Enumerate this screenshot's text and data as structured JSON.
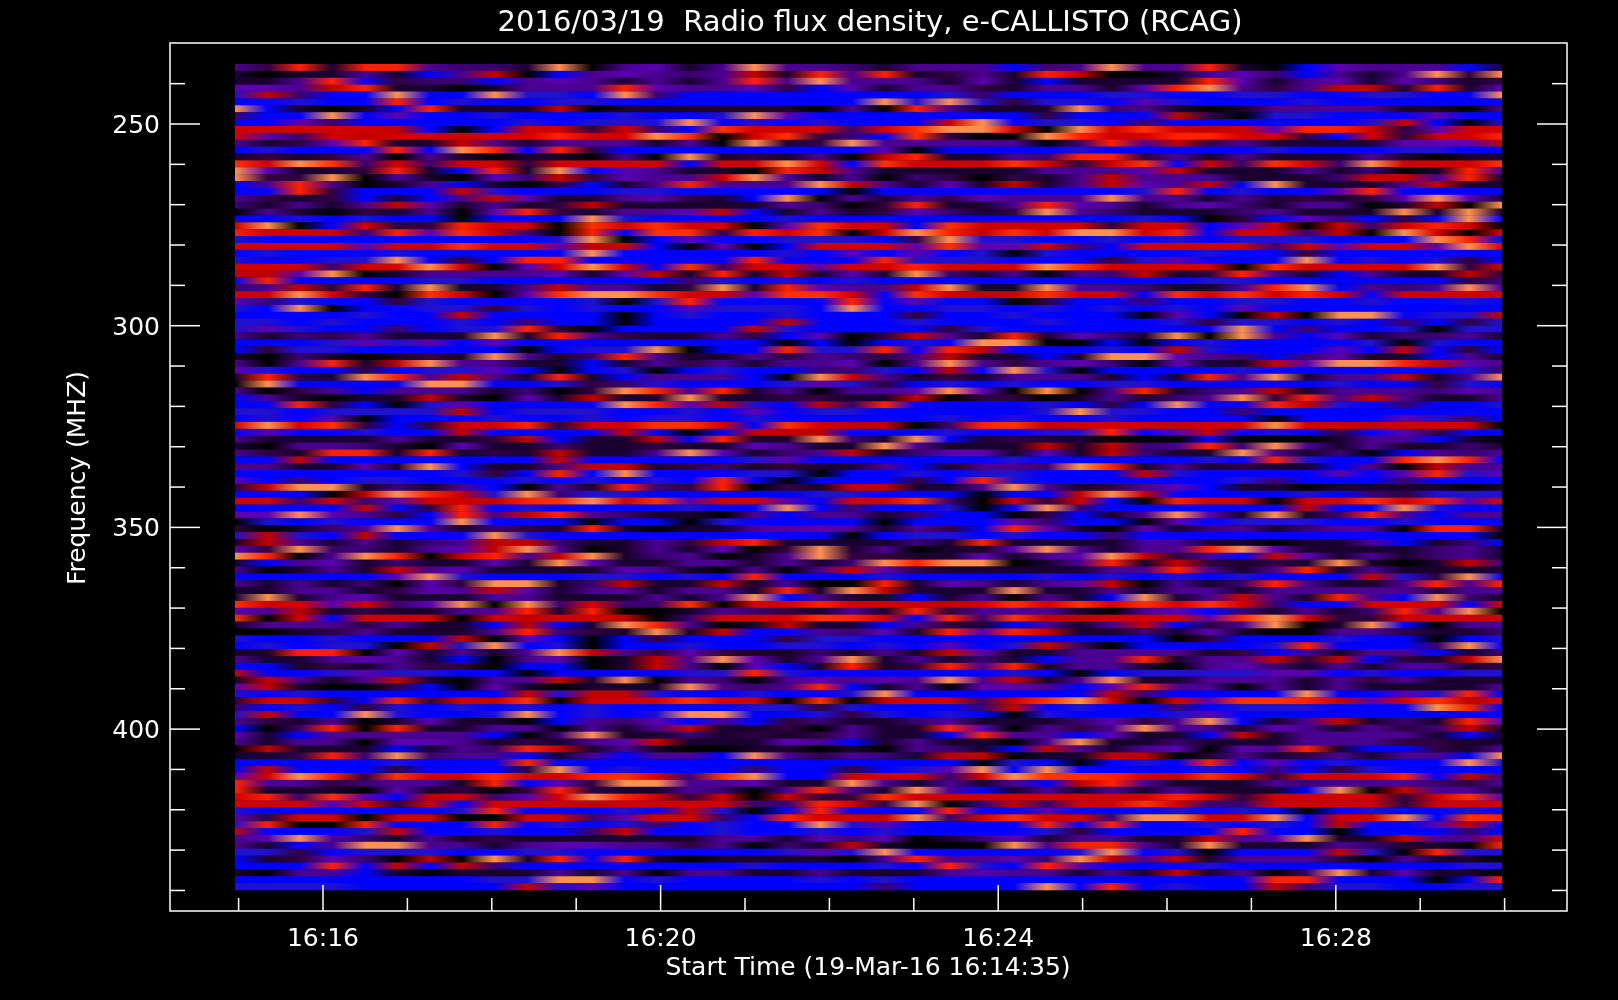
{
  "plot": {
    "title": "2016/03/19  Radio flux density, e-CALLISTO (RCAG)",
    "ylabel": "Frequency (MHZ)",
    "xlabel": "Start Time (19-Mar-16 16:14:35)",
    "yticks": [
      "250",
      "300",
      "350",
      "400"
    ],
    "xticks": [
      "16:16",
      "16:20",
      "16:24",
      "16:28"
    ]
  }
}
